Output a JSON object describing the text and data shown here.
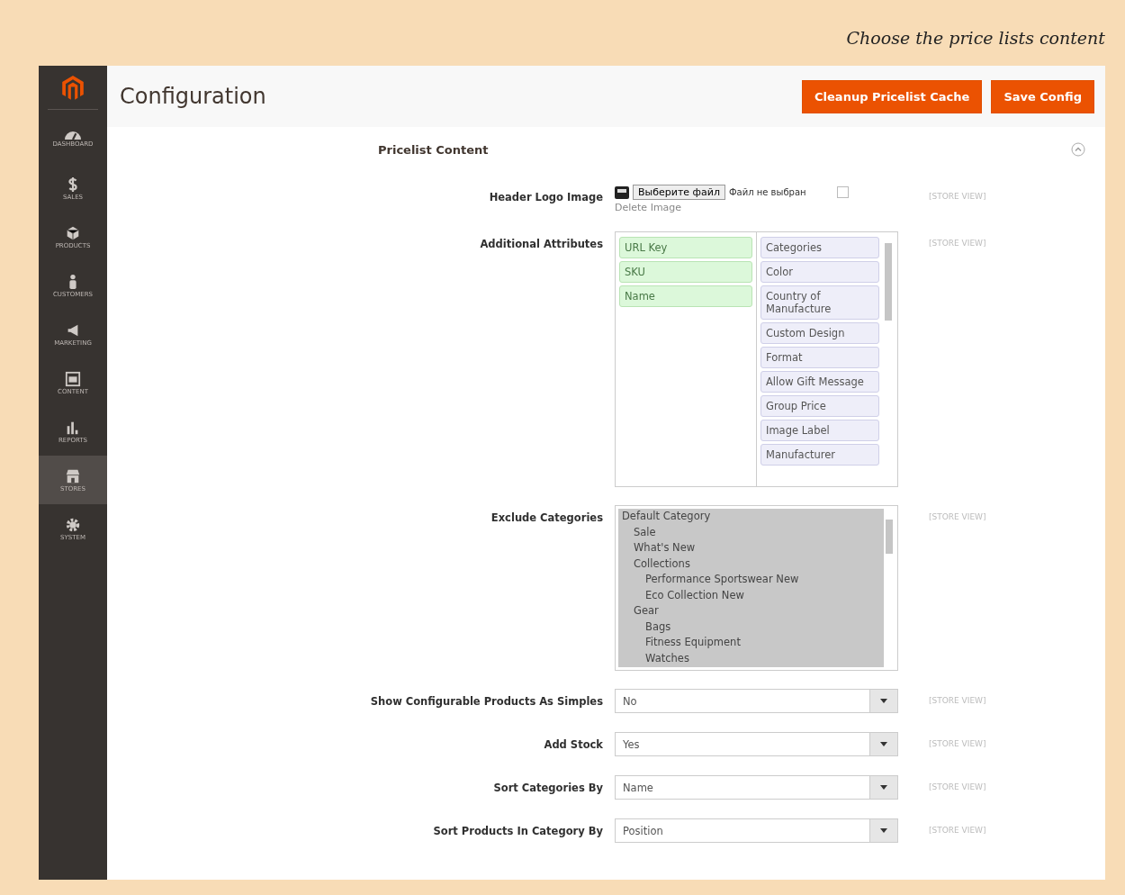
{
  "caption": "Choose the price lists content",
  "sidebar": {
    "items": [
      {
        "label": "DASHBOARD",
        "selected": false
      },
      {
        "label": "SALES",
        "selected": false
      },
      {
        "label": "PRODUCTS",
        "selected": false
      },
      {
        "label": "CUSTOMERS",
        "selected": false
      },
      {
        "label": "MARKETING",
        "selected": false
      },
      {
        "label": "CONTENT",
        "selected": false
      },
      {
        "label": "REPORTS",
        "selected": false
      },
      {
        "label": "STORES",
        "selected": true
      },
      {
        "label": "SYSTEM",
        "selected": false
      }
    ]
  },
  "header": {
    "title": "Configuration",
    "buttons": [
      "Cleanup Pricelist Cache",
      "Save Config"
    ]
  },
  "section": {
    "title": "Pricelist Content",
    "expanded": true
  },
  "fields": [
    {
      "kind": "file",
      "label": "Header Logo Image",
      "button": "Выберите файл",
      "status": "Файл не выбран",
      "delete_checked": false,
      "delete_label": "Delete Image",
      "scope": "[STORE VIEW]"
    },
    {
      "kind": "attributes",
      "label": "Additional Attributes",
      "selected_items": [
        "URL Key",
        "SKU",
        "Name"
      ],
      "available_items": [
        "Categories",
        "Color",
        "Country of Manufacture",
        "Custom Design",
        "Format",
        "Allow Gift Message",
        "Group Price",
        "Image Label",
        "Manufacturer"
      ],
      "scope": "[STORE VIEW]"
    },
    {
      "kind": "tree",
      "label": "Exclude Categories",
      "items": [
        {
          "label": "Default Category",
          "selected": true,
          "children": [
            {
              "label": "Sale",
              "selected": true
            },
            {
              "label": "What's New",
              "selected": true
            },
            {
              "label": "Collections",
              "selected": true,
              "children": [
                {
                  "label": "Performance Sportswear New",
                  "selected": true
                },
                {
                  "label": "Eco Collection New",
                  "selected": true
                }
              ]
            },
            {
              "label": "Gear",
              "selected": true,
              "children": [
                {
                  "label": "Bags",
                  "selected": true
                },
                {
                  "label": "Fitness Equipment",
                  "selected": true
                },
                {
                  "label": "Watches",
                  "selected": true
                }
              ]
            }
          ]
        }
      ],
      "scope": "[STORE VIEW]"
    },
    {
      "kind": "select",
      "label": "Show Configurable Products As Simples",
      "value": "No",
      "scope": "[STORE VIEW]"
    },
    {
      "kind": "select",
      "label": "Add Stock",
      "value": "Yes",
      "scope": "[STORE VIEW]"
    },
    {
      "kind": "select",
      "label": "Sort Categories By",
      "value": "Name",
      "scope": "[STORE VIEW]"
    },
    {
      "kind": "select",
      "label": "Sort Products In Category By",
      "value": "Position",
      "scope": "[STORE VIEW]"
    }
  ]
}
